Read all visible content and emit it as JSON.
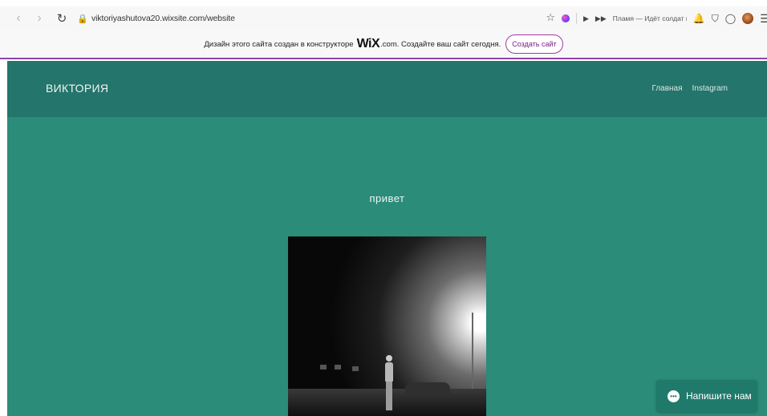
{
  "browser": {
    "url": "viktoriyashutova20.wixsite.com/website",
    "media": {
      "track": "Пламя — Идёт солдат по"
    }
  },
  "wix_banner": {
    "text_before": "Дизайн этого сайта создан в конструкторе",
    "logo": "WiX",
    "text_after": ".com. Создайте ваш сайт сегодня.",
    "button_label": "Создать сайт"
  },
  "site": {
    "logo": "ВИКТОРИЯ",
    "nav": [
      "Главная",
      "Instagram"
    ],
    "greeting": "привет",
    "chat_label": "Напишите нам"
  },
  "colors": {
    "header_bg": "#24756b",
    "main_bg": "#2a8c79",
    "banner_accent": "#8e44ad",
    "chat_bg": "#207a6b"
  },
  "icons": [
    "back-icon",
    "forward-icon",
    "reload-icon",
    "lock-icon",
    "star-icon",
    "extension-icon",
    "play-icon",
    "next-icon",
    "bell-icon",
    "pocket-icon",
    "whatsapp-icon",
    "menu-icon",
    "chat-icon"
  ]
}
